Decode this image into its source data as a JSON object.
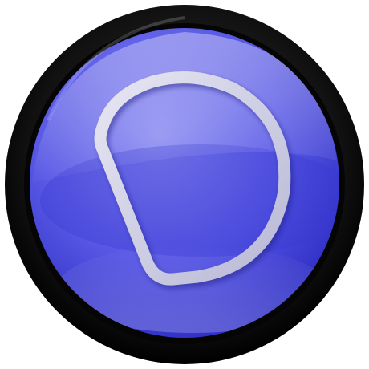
{
  "icon": {
    "name": "app-logo-icon",
    "shape": "round button",
    "glyph": "stylized D outline",
    "colors": {
      "bezel": "#0a0a0a",
      "face_light": "#8e8ef2",
      "face_mid": "#5a5ae6",
      "face_dark": "#2c2cc4",
      "glyph": "#d4d4e6",
      "highlight": "#ffffff"
    }
  }
}
